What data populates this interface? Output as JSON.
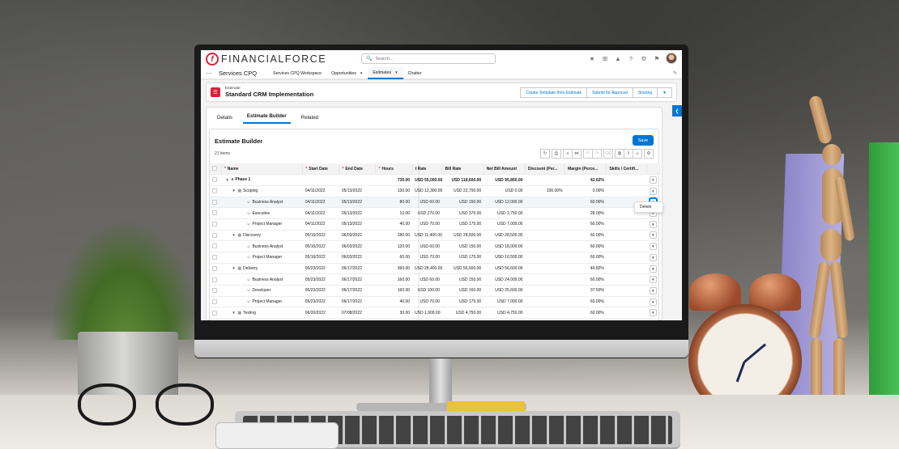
{
  "header": {
    "logo_text": "FINANCIALFORCE",
    "search_placeholder": "Search..."
  },
  "nav": {
    "app_name": "Services CPQ",
    "items": [
      {
        "label": "Services CPQ Workspace"
      },
      {
        "label": "Opportunities"
      },
      {
        "label": "Estimates"
      },
      {
        "label": "Chatter"
      }
    ]
  },
  "record": {
    "type": "Estimate",
    "name": "Standard CRM Implementation",
    "actions": [
      "Create Template from Estimate",
      "Submit for Approval",
      "Sharing"
    ]
  },
  "tabs": [
    "Details",
    "Estimate Builder",
    "Related"
  ],
  "builder": {
    "title": "Estimate Builder",
    "save_label": "Save",
    "item_count": "21 items",
    "row_menu_item": "Delete"
  },
  "columns": [
    "Name",
    "Start Date",
    "End Date",
    "Hours",
    "t Rate",
    "Bill Rate",
    "Net Bill Amount",
    "Discount (Per...",
    "Margin (Perce...",
    "Skills / Certifi..."
  ],
  "rows": [
    {
      "name": "Phase 1",
      "start": "",
      "end": "",
      "hours": "730.00",
      "cost": "USD 55,000.00",
      "bill": "USD 118,600.00",
      "net": "USD 95,850.00",
      "disc": "",
      "margin": "42.62%"
    },
    {
      "name": "Scoping",
      "start": "04/11/2022",
      "end": "05/13/2022",
      "hours": "130.00",
      "cost": "USD 12,300.00",
      "bill": "USD 22,750.00",
      "net": "USD 0.00",
      "disc": "100.00%",
      "margin": "0.00%"
    },
    {
      "name": "Business Analyst",
      "start": "04/11/2022",
      "end": "05/13/2022",
      "hours": "80.00",
      "cost": "USD 60.00",
      "bill": "USD 150.00",
      "net": "USD 12,000.00",
      "disc": "",
      "margin": "60.00%"
    },
    {
      "name": "Executive",
      "start": "04/11/2022",
      "end": "05/13/2022",
      "hours": "10.00",
      "cost": "USD 270.00",
      "bill": "USD 375.00",
      "net": "USD 3,750.00",
      "disc": "",
      "margin": "28.00%"
    },
    {
      "name": "Project Manager",
      "start": "04/11/2022",
      "end": "05/13/2022",
      "hours": "40.00",
      "cost": "USD 70.00",
      "bill": "USD 175.00",
      "net": "USD 7,000.00",
      "disc": "",
      "margin": "60.00%"
    },
    {
      "name": "Discovery",
      "start": "05/16/2022",
      "end": "06/03/2022",
      "hours": "180.00",
      "cost": "USD 11,400.00",
      "bill": "USD 28,500.00",
      "net": "USD 28,500.00",
      "disc": "",
      "margin": "60.00%"
    },
    {
      "name": "Business Analyst",
      "start": "05/16/2022",
      "end": "06/03/2022",
      "hours": "120.00",
      "cost": "USD 60.00",
      "bill": "USD 150.00",
      "net": "USD 18,000.00",
      "disc": "",
      "margin": "60.00%"
    },
    {
      "name": "Project Manager",
      "start": "05/16/2022",
      "end": "06/03/2022",
      "hours": "60.00",
      "cost": "USD 70.00",
      "bill": "USD 175.00",
      "net": "USD 10,500.00",
      "disc": "",
      "margin": "60.00%"
    },
    {
      "name": "Delivery",
      "start": "05/23/2022",
      "end": "06/17/2022",
      "hours": "360.00",
      "cost": "USD 28,400.00",
      "bill": "USD 56,600.00",
      "net": "USD 56,600.00",
      "disc": "",
      "margin": "49.82%"
    },
    {
      "name": "Business Analyst",
      "start": "05/23/2022",
      "end": "06/17/2022",
      "hours": "160.00",
      "cost": "USD 60.00",
      "bill": "USD 150.00",
      "net": "USD 24,000.00",
      "disc": "",
      "margin": "60.00%"
    },
    {
      "name": "Developer",
      "start": "05/23/2022",
      "end": "06/17/2022",
      "hours": "160.00",
      "cost": "USD 100.00",
      "bill": "USD 160.00",
      "net": "USD 25,600.00",
      "disc": "",
      "margin": "37.50%"
    },
    {
      "name": "Project Manager",
      "start": "05/23/2022",
      "end": "06/17/2022",
      "hours": "40.00",
      "cost": "USD 70.00",
      "bill": "USD 175.00",
      "net": "USD 7,000.00",
      "disc": "",
      "margin": "60.00%"
    },
    {
      "name": "Testing",
      "start": "06/20/2022",
      "end": "07/08/2022",
      "hours": "30.00",
      "cost": "USD 1,900.00",
      "bill": "USD 4,750.00",
      "net": "USD 4,750.00",
      "disc": "",
      "margin": "60.00%"
    }
  ],
  "colors": {
    "brand": "#d8223a",
    "accent": "#0176d3"
  }
}
